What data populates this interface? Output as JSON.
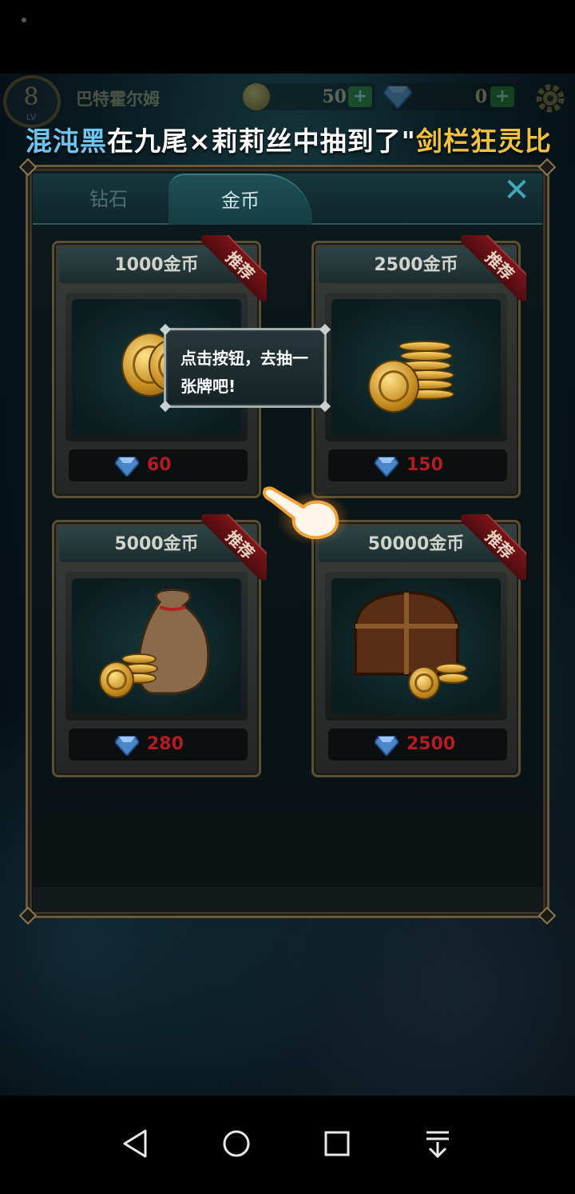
{
  "hud": {
    "level": "8",
    "level_label": "LV",
    "player_name": "巴特霍尔姆",
    "gold": "50",
    "gems": "0",
    "plus": "+"
  },
  "marquee": {
    "player": "混沌黑",
    "text": "在九尾×莉莉丝中抽到了\"",
    "card": "剑栏狂灵比"
  },
  "shop": {
    "tabs": [
      {
        "label": "钻石",
        "active": false
      },
      {
        "label": "金币",
        "active": true
      }
    ],
    "close": "✕",
    "ribbon": "推荐",
    "items": [
      {
        "title": "1000金币",
        "price": "60",
        "icon": "coin-pile-icon"
      },
      {
        "title": "2500金币",
        "price": "150",
        "icon": "coin-stack-icon"
      },
      {
        "title": "5000金币",
        "price": "280",
        "icon": "coin-bag-icon"
      },
      {
        "title": "50000金币",
        "price": "2500",
        "icon": "treasure-chest-icon"
      }
    ]
  },
  "tooltip": {
    "text": "点击按钮，去抽一张牌吧!"
  },
  "colors": {
    "price": "#b51c22",
    "marquee_name": "#6cc6f2",
    "marquee_card": "#f2c23a"
  }
}
